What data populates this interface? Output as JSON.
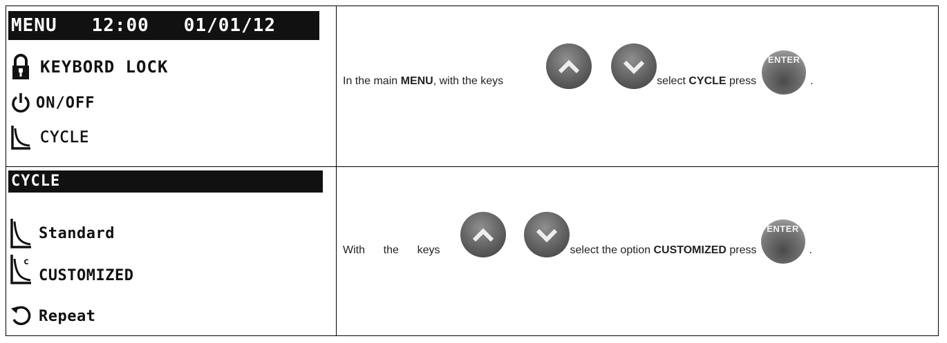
{
  "screen1": {
    "header": "MENU   12:00   01/01/12",
    "items": [
      {
        "label": "KEYBORD LOCK",
        "icon": "lock-icon"
      },
      {
        "label": "ON/OFF",
        "icon": "power-icon"
      },
      {
        "label": "CYCLE",
        "icon": "cycle-curve-icon"
      }
    ]
  },
  "screen2": {
    "header": "CYCLE",
    "items": [
      {
        "label": "Standard",
        "icon": "standard-curve-icon"
      },
      {
        "label": "CUSTOMIZED",
        "icon": "customized-curve-icon"
      },
      {
        "label": "Repeat",
        "icon": "repeat-icon"
      }
    ]
  },
  "instruction1": {
    "part1": "In the main ",
    "menu_word": "MENU",
    "part2": ", with the keys",
    "part3": "select ",
    "cycle_word": "CYCLE",
    "part4": " press",
    "end": "."
  },
  "instruction2": {
    "part1": "With      the      keys",
    "part2": "select the option ",
    "customized_word": "CUSTOMIZED",
    "part3": " press",
    "end": "."
  },
  "enter_key_label": "ENTER"
}
